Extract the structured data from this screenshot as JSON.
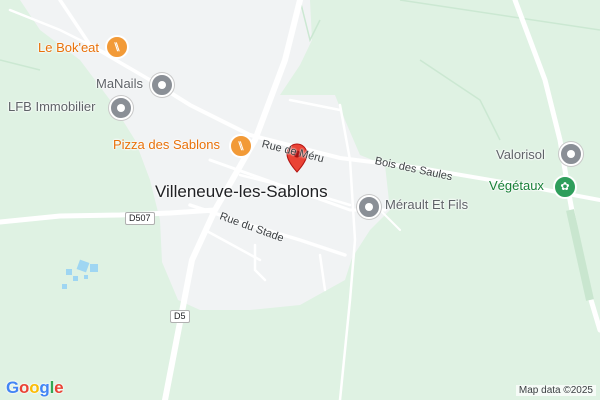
{
  "map": {
    "town_label": "Villeneuve-les-Sablons",
    "streets": {
      "rue_de_meru": "Rue de Méru",
      "bois_des_saules": "Bois des Saules",
      "rue_du_stade": "Rue du Stade"
    },
    "road_shields": {
      "d507": "D507",
      "d5": "D5"
    },
    "places": [
      {
        "name": "Le Bok'eat",
        "icon": "restaurant-icon",
        "color": "#e8710a"
      },
      {
        "name": "MaNails",
        "icon": "place-icon",
        "color": "#5f6368"
      },
      {
        "name": "LFB Immobilier",
        "icon": "place-icon",
        "color": "#5f6368"
      },
      {
        "name": "Pizza des Sablons",
        "icon": "restaurant-icon",
        "color": "#e8710a"
      },
      {
        "name": "Mérault Et Fils",
        "icon": "place-icon",
        "color": "#5f6368"
      },
      {
        "name": "Valorisol",
        "icon": "place-icon",
        "color": "#5f6368"
      },
      {
        "name": "Végétaux",
        "icon": "garden-icon",
        "color": "#188038"
      }
    ],
    "marker": {
      "icon": "red-location-pin-icon",
      "color": "#ea4335"
    },
    "branding": {
      "logo": "Google",
      "attribution": "Map data ©2025"
    },
    "colors": {
      "land": "#dff2e3",
      "urban": "#f1f3f4",
      "road": "#ffffff",
      "water": "#9fd6f2"
    }
  }
}
